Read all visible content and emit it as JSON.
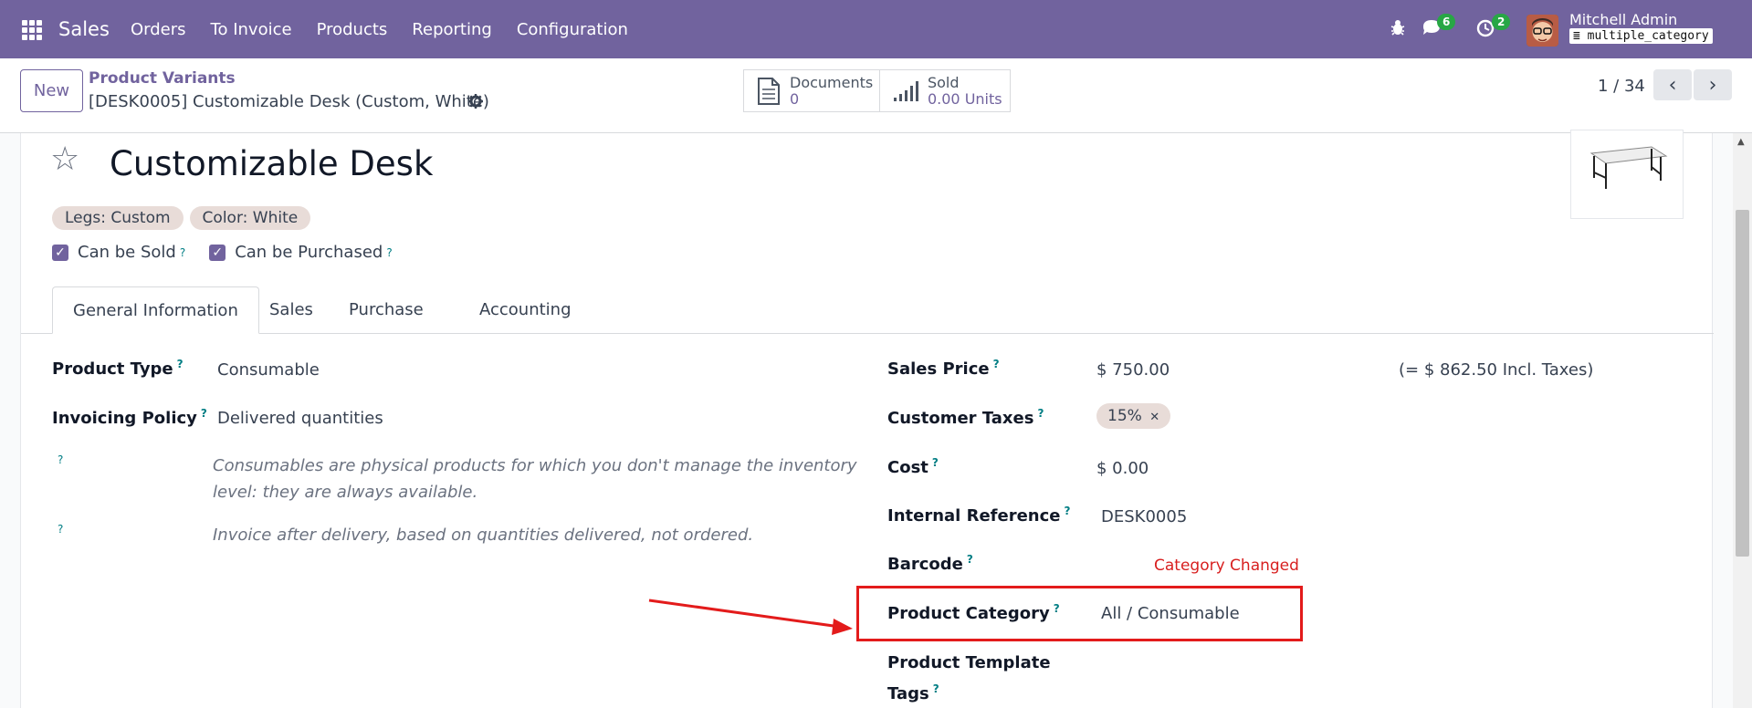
{
  "navbar": {
    "app_name": "Sales",
    "menu": [
      "Orders",
      "To Invoice",
      "Products",
      "Reporting",
      "Configuration"
    ],
    "messages_count": "6",
    "activities_count": "2",
    "user_name": "Mitchell Admin",
    "database": "multiple_category"
  },
  "control": {
    "new_label": "New",
    "breadcrumb_parent": "Product Variants",
    "breadcrumb_current": "[DESK0005] Customizable Desk (Custom, White)",
    "smart_documents_label": "Documents",
    "smart_documents_value": "0",
    "smart_sold_label": "Sold",
    "smart_sold_value": "0.00 Units",
    "pager": "1 / 34"
  },
  "form": {
    "title": "Customizable Desk",
    "attributes": [
      "Legs: Custom",
      "Color: White"
    ],
    "can_be_sold": "Can be Sold",
    "can_be_purchased": "Can be Purchased",
    "tabs": [
      "General Information",
      "Sales",
      "Purchase",
      "Accounting"
    ],
    "product_type_label": "Product Type",
    "product_type_value": "Consumable",
    "invoicing_policy_label": "Invoicing Policy",
    "invoicing_policy_value": "Delivered quantities",
    "product_type_help": "Consumables are physical products for which you don't manage the inventory level: they are always available.",
    "invoicing_help": "Invoice after delivery, based on quantities delivered, not ordered.",
    "sales_price_label": "Sales Price",
    "sales_price_value": "$ 750.00",
    "incl_taxes": "(= $ 862.50 Incl. Taxes)",
    "customer_taxes_label": "Customer Taxes",
    "customer_taxes_value": "15%",
    "cost_label": "Cost",
    "cost_value": "$ 0.00",
    "internal_ref_label": "Internal Reference",
    "internal_ref_value": "DESK0005",
    "barcode_label": "Barcode",
    "product_category_label": "Product Category",
    "product_category_value": "All / Consumable",
    "template_tags_label_1": "Product Template",
    "template_tags_label_2": "Tags"
  },
  "annotation": {
    "text": "Category Changed",
    "color": "#e31b1b"
  },
  "colors": {
    "navbar": "#71639e",
    "accent": "#71639e",
    "help": "#017e84"
  }
}
